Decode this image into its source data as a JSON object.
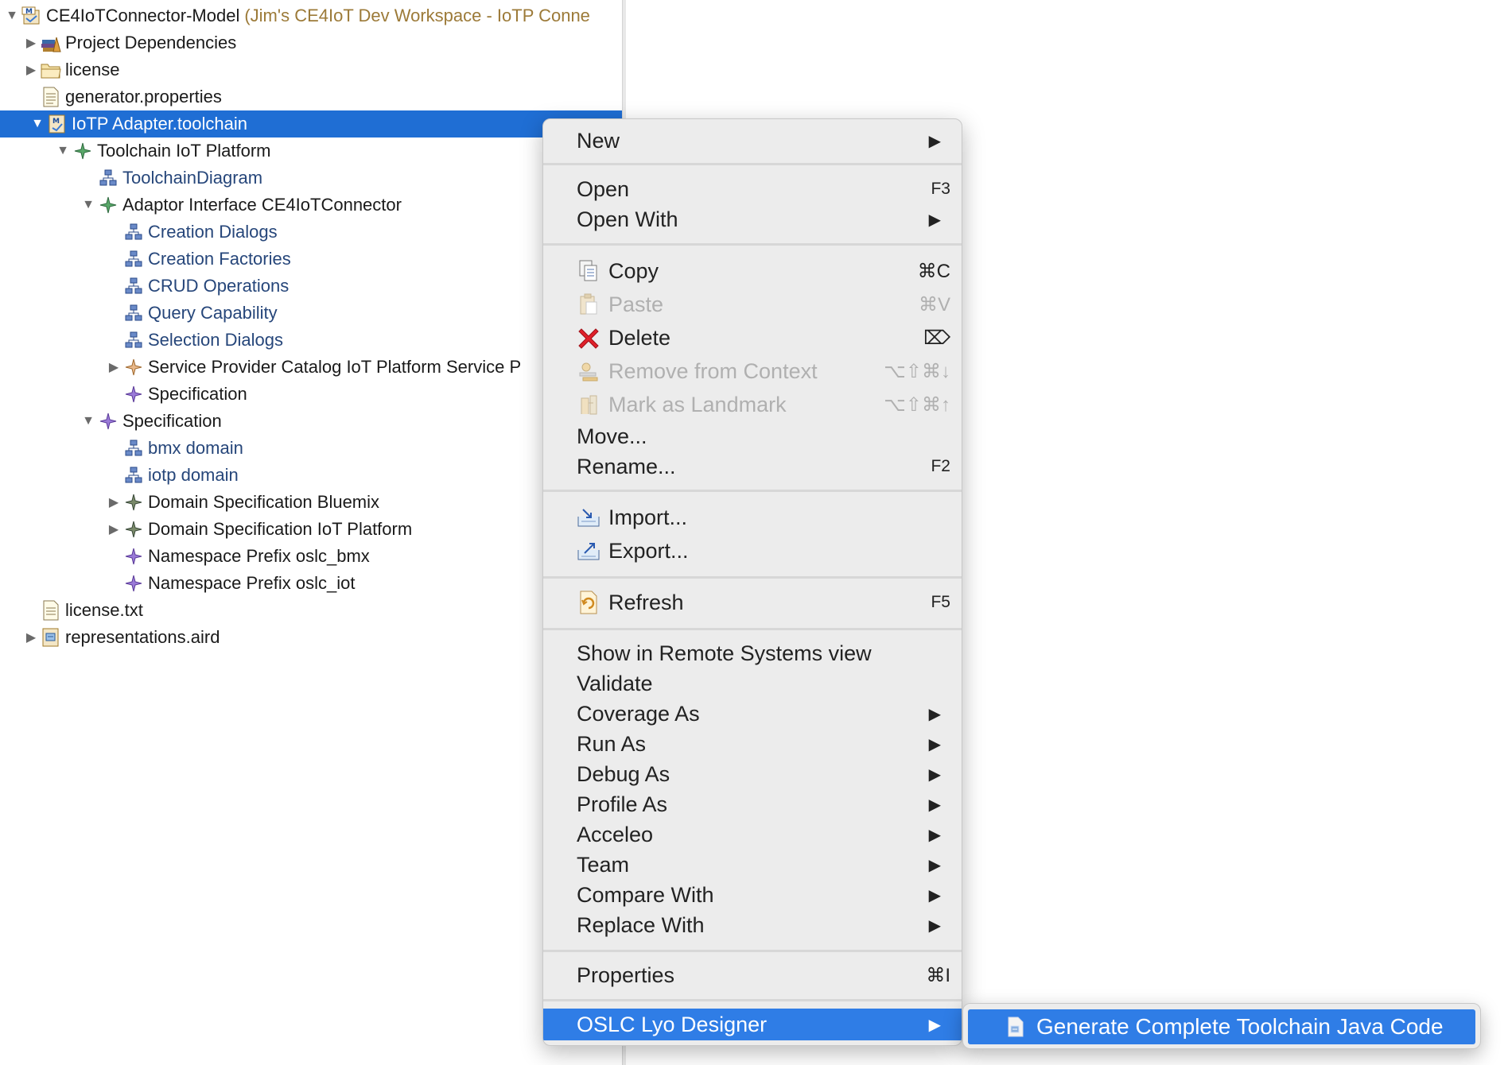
{
  "tree": {
    "rows": [
      {
        "label": "CE4IoTConnector-Model",
        "annotation": "(Jim's CE4IoT Dev Workspace - IoTP Conne",
        "icon": "model-project-icon",
        "twisty": "expanded"
      },
      {
        "label": "Project Dependencies",
        "icon": "library-icon",
        "twisty": "collapsed"
      },
      {
        "label": "license",
        "icon": "folder-icon",
        "twisty": "collapsed"
      },
      {
        "label": "generator.properties",
        "icon": "properties-file-icon",
        "twisty": "none"
      },
      {
        "label": "IoTP Adapter.toolchain",
        "icon": "toolchain-file-icon",
        "twisty": "expanded",
        "selected": true
      },
      {
        "label": "Toolchain IoT Platform",
        "icon": "diamond-green-icon",
        "twisty": "expanded"
      },
      {
        "label": "ToolchainDiagram",
        "icon": "diagram-icon",
        "twisty": "none",
        "link": true
      },
      {
        "label": "Adaptor Interface CE4IoTConnector",
        "icon": "diamond-green-icon",
        "twisty": "expanded"
      },
      {
        "label": "Creation Dialogs",
        "icon": "diagram-icon",
        "twisty": "none",
        "link": true
      },
      {
        "label": "Creation Factories",
        "icon": "diagram-icon",
        "twisty": "none",
        "link": true
      },
      {
        "label": "CRUD Operations",
        "icon": "diagram-icon",
        "twisty": "none",
        "link": true
      },
      {
        "label": "Query Capability",
        "icon": "diagram-icon",
        "twisty": "none",
        "link": true
      },
      {
        "label": "Selection Dialogs",
        "icon": "diagram-icon",
        "twisty": "none",
        "link": true
      },
      {
        "label": "Service Provider Catalog IoT Platform Service P",
        "icon": "diamond-orange-icon",
        "twisty": "collapsed"
      },
      {
        "label": "Specification",
        "icon": "diamond-purple-icon",
        "twisty": "none"
      },
      {
        "label": "Specification",
        "icon": "diamond-purple-icon",
        "twisty": "expanded"
      },
      {
        "label": "bmx domain",
        "icon": "diagram-icon",
        "twisty": "none",
        "link": true
      },
      {
        "label": "iotp domain",
        "icon": "diagram-icon",
        "twisty": "none",
        "link": true
      },
      {
        "label": "Domain Specification Bluemix",
        "icon": "diamond-dark-icon",
        "twisty": "collapsed"
      },
      {
        "label": "Domain Specification IoT Platform",
        "icon": "diamond-dark-icon",
        "twisty": "collapsed"
      },
      {
        "label": "Namespace Prefix oslc_bmx",
        "icon": "diamond-purple-icon",
        "twisty": "none"
      },
      {
        "label": "Namespace Prefix oslc_iot",
        "icon": "diamond-purple-icon",
        "twisty": "none"
      },
      {
        "label": "license.txt",
        "icon": "text-file-icon",
        "twisty": "none"
      },
      {
        "label": "representations.aird",
        "icon": "aird-file-icon",
        "twisty": "collapsed"
      }
    ]
  },
  "menu": {
    "items": [
      {
        "label": "New",
        "submenu": true
      },
      {
        "label": "Open",
        "shortcut": "F3"
      },
      {
        "label": "Open With",
        "submenu": true
      },
      {
        "label": "Copy",
        "shortcut": "⌘C",
        "icon": "copy-icon"
      },
      {
        "label": "Paste",
        "shortcut": "⌘V",
        "icon": "paste-icon",
        "disabled": true
      },
      {
        "label": "Delete",
        "shortcut": "⌦",
        "icon": "delete-icon"
      },
      {
        "label": "Remove from Context",
        "shortcut": "⌥⇧⌘↓",
        "icon": "remove-context-icon",
        "disabled": true
      },
      {
        "label": "Mark as Landmark",
        "shortcut": "⌥⇧⌘↑",
        "icon": "landmark-icon",
        "disabled": true
      },
      {
        "label": "Move..."
      },
      {
        "label": "Rename...",
        "shortcut": "F2"
      },
      {
        "label": "Import...",
        "icon": "import-icon"
      },
      {
        "label": "Export...",
        "icon": "export-icon"
      },
      {
        "label": "Refresh",
        "shortcut": "F5",
        "icon": "refresh-icon"
      },
      {
        "label": "Show in Remote Systems view"
      },
      {
        "label": "Validate"
      },
      {
        "label": "Coverage As",
        "submenu": true
      },
      {
        "label": "Run As",
        "submenu": true
      },
      {
        "label": "Debug As",
        "submenu": true
      },
      {
        "label": "Profile As",
        "submenu": true
      },
      {
        "label": "Acceleo",
        "submenu": true
      },
      {
        "label": "Team",
        "submenu": true
      },
      {
        "label": "Compare With",
        "submenu": true
      },
      {
        "label": "Replace With",
        "submenu": true
      },
      {
        "label": "Properties",
        "shortcut": "⌘I"
      },
      {
        "label": "OSLC Lyo Designer",
        "submenu": true,
        "active": true
      }
    ]
  },
  "submenu": {
    "item_label": "Generate Complete Toolchain Java Code",
    "icon": "generate-code-icon"
  },
  "colors": {
    "selection": "#1f6ed4",
    "menu_highlight": "#2f7de6",
    "link_text": "#26467a",
    "project_annotation": "#9c7a38"
  }
}
